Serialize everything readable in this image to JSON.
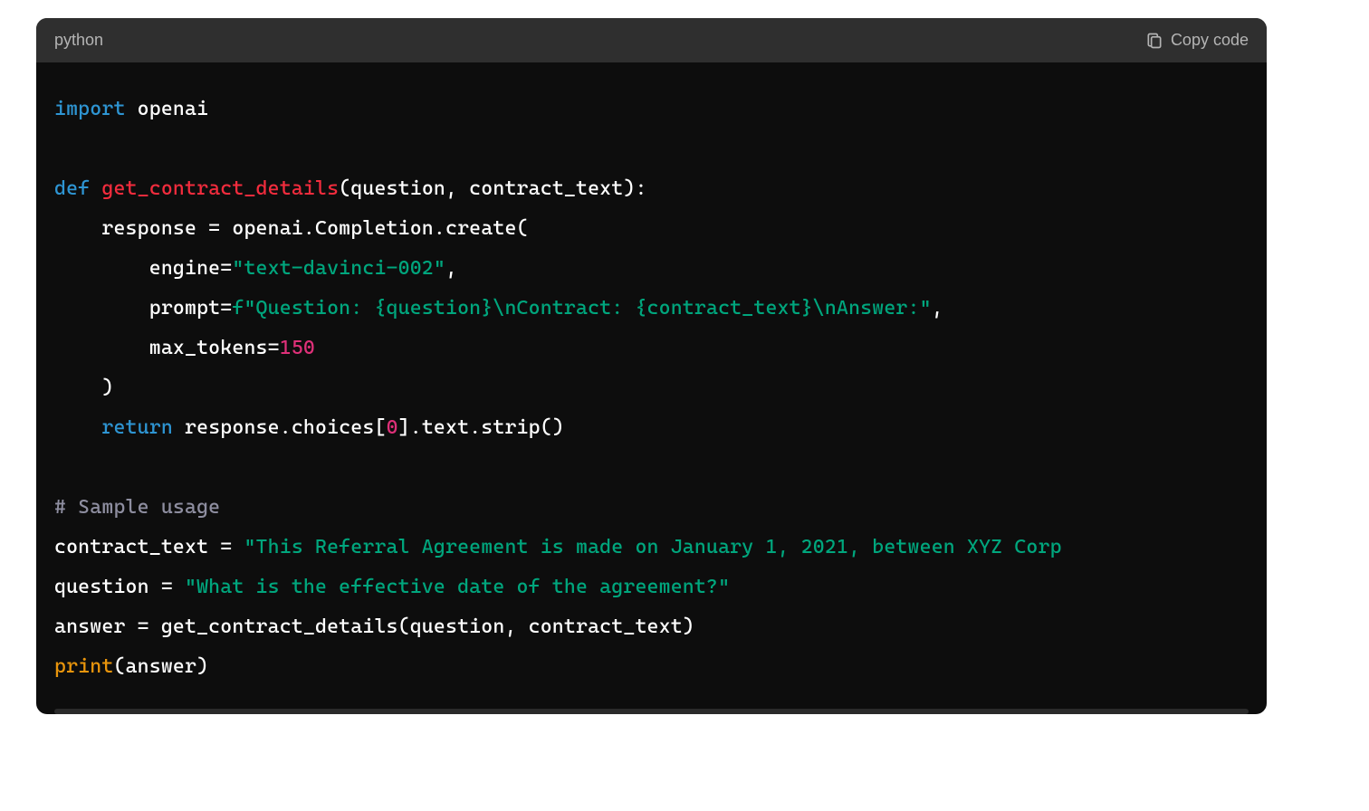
{
  "header": {
    "language": "python",
    "copy_label": "Copy code"
  },
  "code": {
    "line1": {
      "import_kw": "import",
      "module": " openai"
    },
    "line3": {
      "def_kw": "def",
      "space": " ",
      "fname": "get_contract_details",
      "params": "(question, contract_text):"
    },
    "line4": {
      "indent": "    response = openai.Completion.create("
    },
    "line5": {
      "indent": "        engine=",
      "str": "\"text-davinci-002\"",
      "comma": ","
    },
    "line6": {
      "indent": "        prompt=",
      "fprefix": "f",
      "str": "\"Question: {question}\\nContract: {contract_text}\\nAnswer:\"",
      "comma": ","
    },
    "line7": {
      "indent": "        max_tokens=",
      "num": "150"
    },
    "line8": {
      "text": "    )"
    },
    "line9": {
      "indent": "    ",
      "return_kw": "return",
      "rest1": " response.choices[",
      "zero": "0",
      "rest2": "].text.strip()"
    },
    "line11": {
      "comment": "# Sample usage"
    },
    "line12": {
      "lhs": "contract_text = ",
      "str": "\"This Referral Agreement is made on January 1, 2021, between XYZ Corp"
    },
    "line13": {
      "lhs": "question = ",
      "str": "\"What is the effective date of the agreement?\""
    },
    "line14": {
      "text": "answer = get_contract_details(question, contract_text)"
    },
    "line15": {
      "print_kw": "print",
      "rest": "(answer)"
    }
  }
}
